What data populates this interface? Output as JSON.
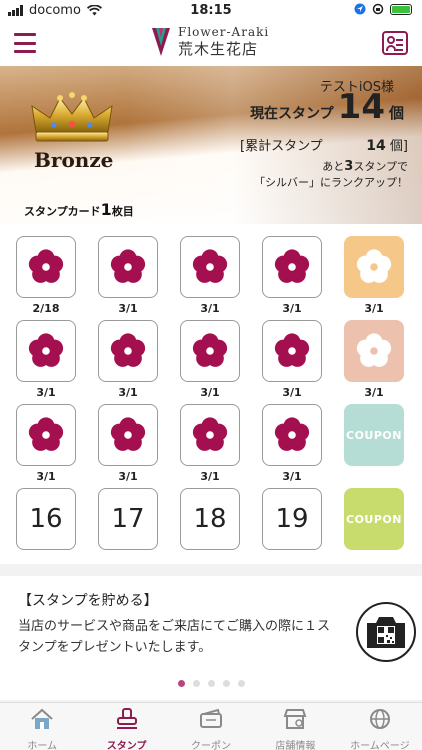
{
  "status_bar": {
    "carrier": "docomo",
    "time": "18:15",
    "battery_color": "#3cc13c"
  },
  "header": {
    "brand_en": "Flower-Araki",
    "brand_ja": "荒木生花店",
    "menu_icon": "hamburger-menu-icon",
    "member_icon": "member-card-icon",
    "accent": "#8d1b4f"
  },
  "banner": {
    "rank": "Bronze",
    "user_name": "テストiOS様",
    "current_label": "現在スタンプ",
    "current_value": "14",
    "current_unit": "個",
    "cumulative_label": "[累計スタンプ",
    "cumulative_value": "14",
    "cumulative_unit": "個]",
    "advance_pre": "あと",
    "advance_num": "3",
    "advance_post": "スタンプで",
    "advance_line2": "「シルバー」にランクアップ！",
    "card_label_pre": "スタンプカード",
    "card_count": "1",
    "card_label_post": "枚目"
  },
  "stamp_card": {
    "stamp_color": "#a4104f",
    "cells": [
      {
        "kind": "stamp",
        "date": "2/18"
      },
      {
        "kind": "stamp",
        "date": "3/1"
      },
      {
        "kind": "stamp",
        "date": "3/1"
      },
      {
        "kind": "stamp",
        "date": "3/1"
      },
      {
        "kind": "reward",
        "style": "flower",
        "color": "#f5c88a",
        "date": "3/1"
      },
      {
        "kind": "stamp",
        "date": "3/1"
      },
      {
        "kind": "stamp",
        "date": "3/1"
      },
      {
        "kind": "stamp",
        "date": "3/1"
      },
      {
        "kind": "stamp",
        "date": "3/1"
      },
      {
        "kind": "reward",
        "style": "flower",
        "color": "#ecc2ae",
        "date": "3/1"
      },
      {
        "kind": "stamp",
        "date": "3/1"
      },
      {
        "kind": "stamp",
        "date": "3/1"
      },
      {
        "kind": "stamp",
        "date": "3/1"
      },
      {
        "kind": "stamp",
        "date": "3/1"
      },
      {
        "kind": "reward",
        "style": "coupon",
        "color": "#b5ddd5",
        "label": "COUPON"
      },
      {
        "kind": "empty",
        "number": "16"
      },
      {
        "kind": "empty",
        "number": "17"
      },
      {
        "kind": "empty",
        "number": "18"
      },
      {
        "kind": "empty",
        "number": "19"
      },
      {
        "kind": "reward",
        "style": "coupon",
        "color": "#c8dc6e",
        "label": "COUPON"
      }
    ]
  },
  "info": {
    "title": "【スタンプを貯める】",
    "body": "当店のサービスや商品をご来店にてご購入の際に１スタンプをプレゼントいたします。",
    "camera_icon": "qr-camera-icon",
    "page_count": 5,
    "active_page": 0
  },
  "tabs": [
    {
      "label": "ホーム",
      "icon": "home-icon",
      "active": false
    },
    {
      "label": "スタンプ",
      "icon": "stamp-icon",
      "active": true
    },
    {
      "label": "クーポン",
      "icon": "coupon-icon",
      "active": false
    },
    {
      "label": "店舗情報",
      "icon": "store-icon",
      "active": false
    },
    {
      "label": "ホームページ",
      "icon": "globe-icon",
      "active": false
    }
  ]
}
